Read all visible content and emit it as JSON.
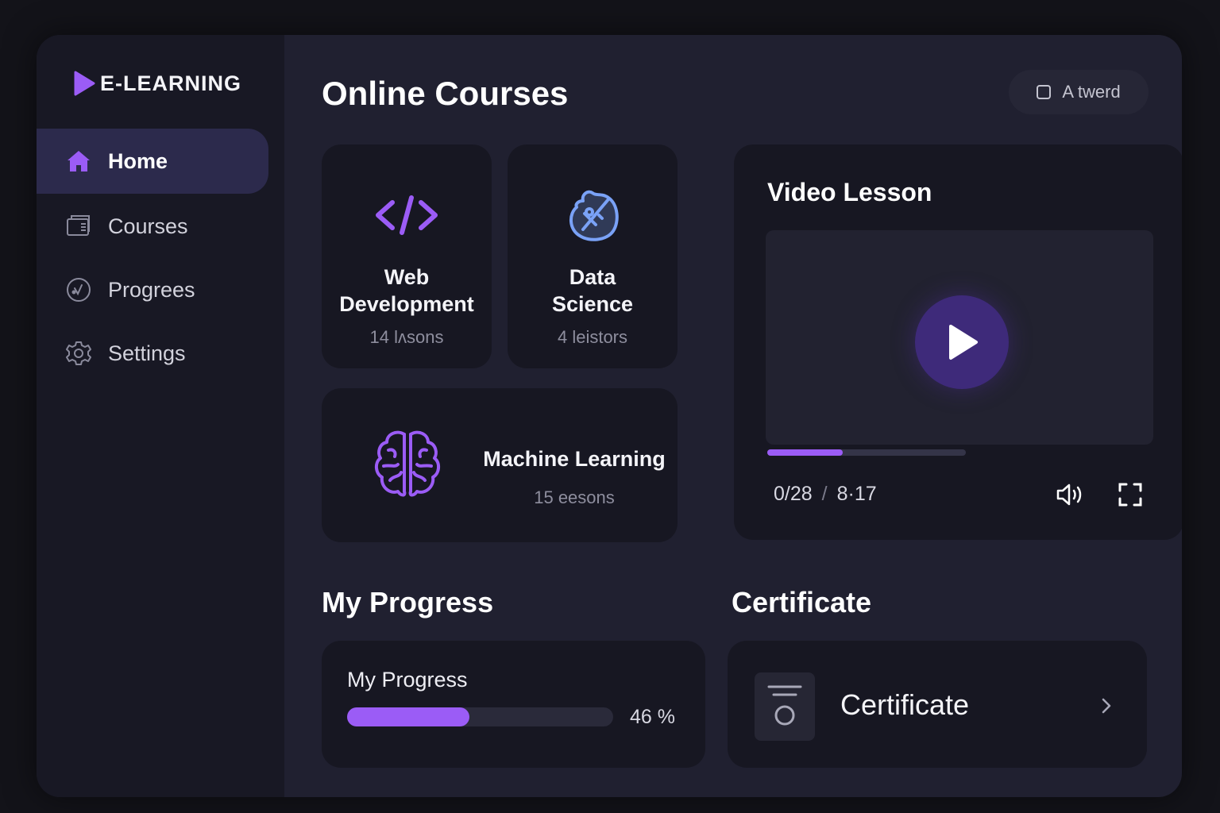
{
  "sidebar": {
    "logo_text": "E-LEARNING",
    "items": [
      {
        "label": "Home",
        "icon": "home-icon",
        "active": true
      },
      {
        "label": "Courses",
        "icon": "courses-icon",
        "active": false
      },
      {
        "label": "Progrees",
        "icon": "progress-icon",
        "active": false
      },
      {
        "label": "Settings",
        "icon": "gear-icon",
        "active": false
      }
    ]
  },
  "header": {
    "title": "Online Courses",
    "button_label": "A twerd"
  },
  "courses": [
    {
      "title_line1": "Web",
      "title_line2": "Development",
      "lessons": "14 lʌsons",
      "icon": "code-icon"
    },
    {
      "title_line1": "Data",
      "title_line2": "Science",
      "lessons": "4 leistors",
      "icon": "data-science-icon"
    },
    {
      "title": "Machine Learning",
      "lessons": "15 eesons",
      "icon": "brain-icon"
    }
  ],
  "video": {
    "title": "Video Lesson",
    "current_time": "0/28",
    "separator": "/",
    "duration": "8·17",
    "progress": 0.38
  },
  "progress_section": {
    "title": "My Progress",
    "label": "My Progress",
    "value": 0.46,
    "percent_text": "46 %"
  },
  "certificate_section": {
    "title": "Certificate",
    "label": "Certificate"
  },
  "colors": {
    "accent": "#9b5cf6",
    "background": "#202030",
    "sidebar": "#181824",
    "card": "#171722",
    "active_nav": "#2c2a4c",
    "data_science_icon": "#7aa2f7"
  }
}
